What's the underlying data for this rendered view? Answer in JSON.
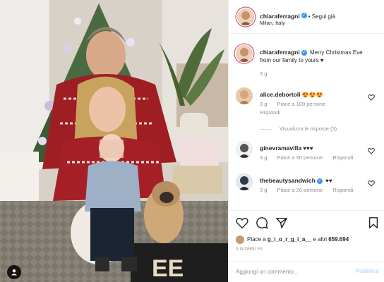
{
  "header": {
    "username": "chiaraferragni",
    "follow_label": "• Segui già",
    "location": "Milan, Italy"
  },
  "caption": {
    "username": "chiaraferragni",
    "text": "Merry Christmas Eve from our family to yours ♥",
    "time": "3 g"
  },
  "comments": [
    {
      "username": "alice.debortoli",
      "text": "😍😍😍",
      "time": "3 g",
      "likes": "Piace a 100 persone",
      "reply": "Rispondi",
      "view_replies": "Visualizza le risposte (3)"
    },
    {
      "username": "ginevramavilla",
      "text": "♥♥♥",
      "time": "3 g",
      "likes": "Piace a 50 persone",
      "reply": "Rispondi"
    },
    {
      "username": "thebeautysandwich",
      "text": "♥♥",
      "time": "3 g",
      "likes": "Piace a 26 persone",
      "reply": "Rispondi"
    }
  ],
  "likes": {
    "prefix": "Piace a",
    "user": "g_i_o_r_g_i_a__",
    "suffix": "e altri",
    "count": "659.694"
  },
  "date": "3 GIORNI FA",
  "comment_box": {
    "placeholder": "Aggiungi un commento...",
    "publish_label": "Pubblica"
  },
  "colors": {
    "accent": "#3897f0",
    "publish_disabled": "#b2dffc",
    "text": "#262626",
    "muted": "#8e8e8e"
  },
  "icons": [
    "heart-icon",
    "comment-icon",
    "share-icon",
    "bookmark-icon",
    "user-tag-icon",
    "verified-badge-icon"
  ]
}
